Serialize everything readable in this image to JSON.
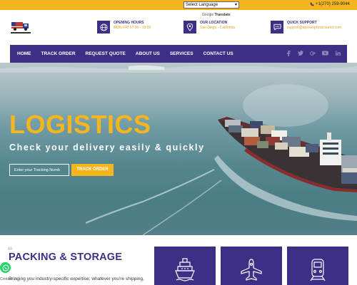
{
  "topbar": {
    "language_select": "Select Language",
    "phone": "+1(270) 259-9044",
    "translate_prefix": "Google",
    "translate_label": "Translate"
  },
  "header": {
    "hours": {
      "title": "OPENING HOURS",
      "value": "MON-FRI 07:00 - 19:00"
    },
    "location": {
      "title": "OUR LOCATION",
      "value": "San Diego - California"
    },
    "support": {
      "title": "QUICK SUPPORT",
      "value": "support@apexexpresscourier.com"
    }
  },
  "nav": {
    "items": [
      "HOME",
      "TRACK ORDER",
      "REQUEST QUOTE",
      "ABOUT US",
      "SERVICES",
      "CONTACT US"
    ],
    "social": [
      "facebook-icon",
      "twitter-icon",
      "google-plus-icon",
      "youtube-icon",
      "linkedin-icon"
    ]
  },
  "hero": {
    "title": "LOGISTICS",
    "subtitle": "Check your delivery easily & quickly",
    "tracking_placeholder": "Enter your Tracking Numb",
    "track_button": "TRACK ORDER"
  },
  "section": {
    "title": "PACKING & STORAGE",
    "body": "Bringing you industry-specific expertise; whatever you're shipping,"
  },
  "whatsapp": {
    "label": "Contact us"
  },
  "cards": [
    "ship-icon",
    "airplane-icon",
    "train-icon"
  ],
  "colors": {
    "brand_purple": "#3c2f85",
    "accent_yellow": "#f5b51f",
    "whatsapp_green": "#25d366"
  }
}
